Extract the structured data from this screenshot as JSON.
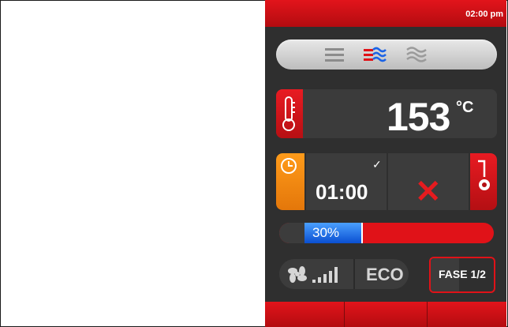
{
  "topbar": {
    "time": "02:00 pm"
  },
  "modes": {
    "items": [
      {
        "name": "dry-heat",
        "icon": "three-lines-icon",
        "active": false,
        "color": "#8c8c8c"
      },
      {
        "name": "convection-steam",
        "icon": "red-blue-waves-icon",
        "active": true,
        "color": "#e01218"
      },
      {
        "name": "steam",
        "icon": "grey-waves-icon",
        "active": false,
        "color": "#9a9a9a"
      }
    ]
  },
  "temperature": {
    "value": "153",
    "unit": "°C",
    "icon": "thermometer-icon"
  },
  "timer": {
    "value": "01:00",
    "icon": "clock-icon",
    "status_icon": "checkmark-icon"
  },
  "probe": {
    "status_icon": "x-icon",
    "icon": "core-probe-icon"
  },
  "progress": {
    "percent": 30,
    "label": "30%"
  },
  "fan": {
    "icon": "fan-icon",
    "level_icon": "signal-bars-icon",
    "eco_label": "ECO"
  },
  "phase": {
    "label": "FASE 1/2"
  },
  "colors": {
    "accent_red": "#e01218",
    "accent_orange": "#f28a12",
    "panel_dark": "#2f2f2f",
    "progress_blue": "#1b63e6"
  }
}
